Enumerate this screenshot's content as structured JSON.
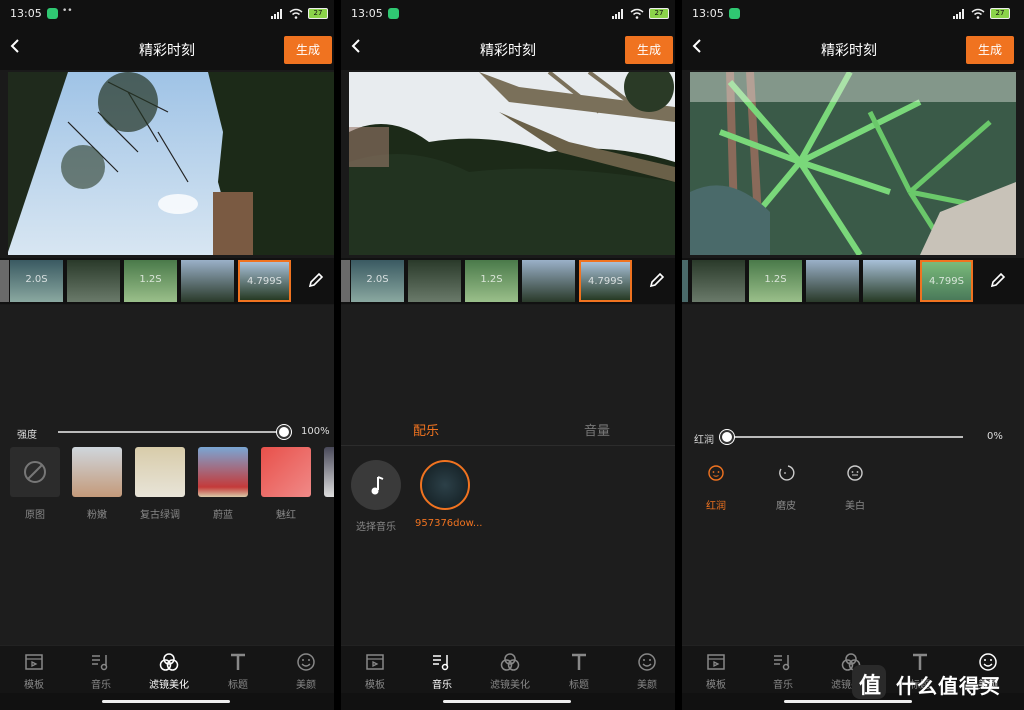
{
  "status_bar": {
    "time": "13:05",
    "battery": "27"
  },
  "header": {
    "title": "精彩时刻",
    "generate_label": "生成"
  },
  "thumbnails": [
    {
      "duration": "2.0S"
    },
    {
      "duration": ""
    },
    {
      "duration": "1.2S"
    },
    {
      "duration": ""
    },
    {
      "duration": "4.799S"
    }
  ],
  "screens": {
    "filter": {
      "intensity_label": "强度",
      "intensity_value": "100%",
      "intensity_fraction": 1.0,
      "filters": [
        {
          "name": "原图"
        },
        {
          "name": "粉嫩"
        },
        {
          "name": "复古绿调"
        },
        {
          "name": "蔚蓝"
        },
        {
          "name": "魅红"
        }
      ]
    },
    "music": {
      "tabs": [
        {
          "label": "配乐"
        },
        {
          "label": "音量"
        }
      ],
      "items": [
        {
          "label": "选择音乐"
        },
        {
          "label": "957376dow..."
        }
      ]
    },
    "beauty": {
      "slider_label": "红润",
      "slider_value": "0%",
      "slider_fraction": 0.0,
      "options": [
        {
          "label": "红润"
        },
        {
          "label": "磨皮"
        },
        {
          "label": "美白"
        }
      ]
    }
  },
  "bottom_nav": [
    {
      "label": "模板",
      "icon": "template-icon"
    },
    {
      "label": "音乐",
      "icon": "music-icon"
    },
    {
      "label": "滤镜美化",
      "icon": "filter-icon"
    },
    {
      "label": "标题",
      "icon": "title-icon"
    },
    {
      "label": "美颜",
      "icon": "beauty-icon"
    }
  ],
  "watermark": {
    "logo_char": "值",
    "text": "什么值得买"
  },
  "colors": {
    "accent": "#f07320",
    "background": "#1a1a1a"
  }
}
